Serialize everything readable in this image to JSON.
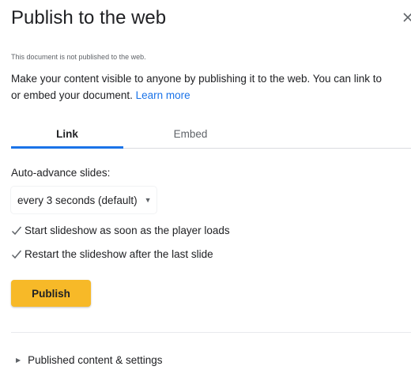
{
  "dialog": {
    "title": "Publish to the web",
    "close_icon": "close-icon",
    "status": "This document is not published to the web.",
    "description_line1": "Make your content visible to anyone by publishing it to the web. You can link to",
    "description_line2": "or embed your document.",
    "learn_more": "Learn more"
  },
  "tabs": [
    {
      "label": "Link",
      "active": true
    },
    {
      "label": "Embed",
      "active": false
    }
  ],
  "auto_advance": {
    "label": "Auto-advance slides:",
    "selected": "every 3 seconds (default)",
    "dropdown_icon": "caret-down-icon"
  },
  "options": [
    {
      "label": "Start slideshow as soon as the player loads",
      "checked": true
    },
    {
      "label": "Restart the slideshow after the last slide",
      "checked": true
    }
  ],
  "publish_button": "Publish",
  "published_settings": {
    "label": "Published content & settings",
    "icon": "triangle-right-icon"
  },
  "colors": {
    "accent": "#1a73e8",
    "publish": "#f7b928"
  }
}
